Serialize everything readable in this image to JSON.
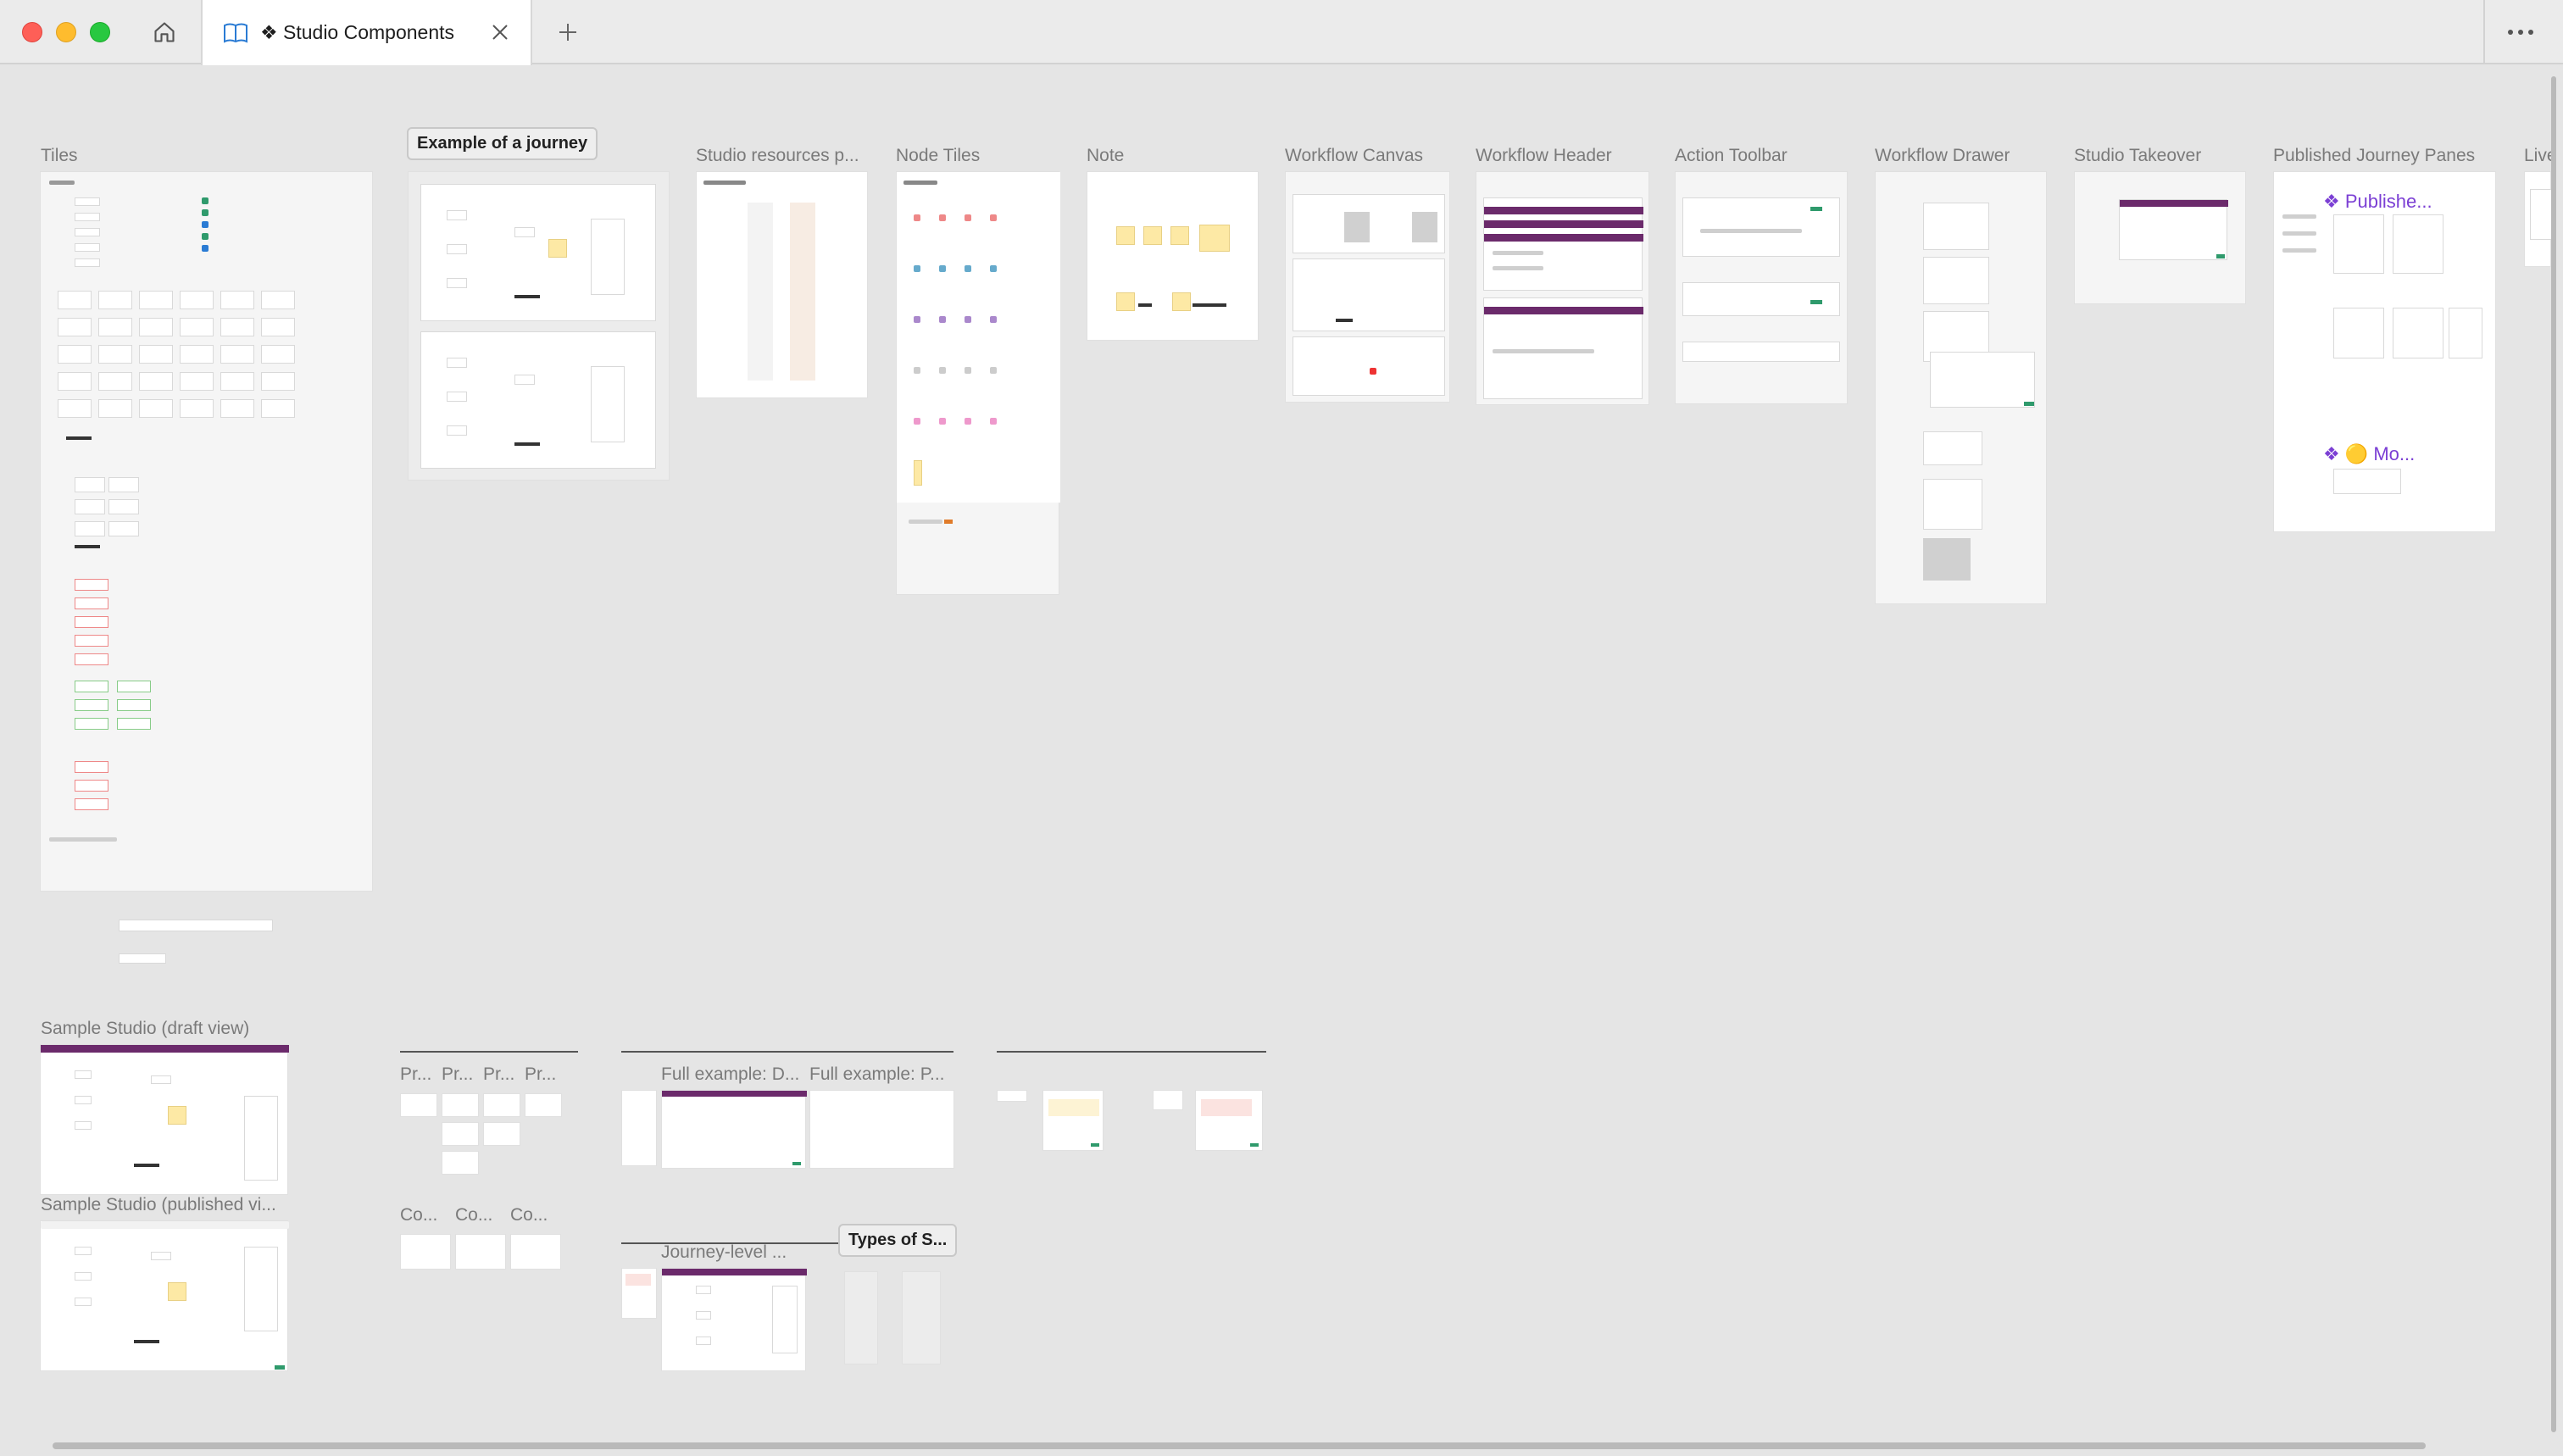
{
  "window": {
    "tab_title": "❖ Studio Components",
    "icons": {
      "home": "home-icon",
      "book": "book-icon",
      "close": "close-icon",
      "add": "plus-icon",
      "more": "more-icon"
    },
    "colors": {
      "close_light": "#fe5f57",
      "minimize_light": "#febc2e",
      "zoom_light": "#28c840",
      "accent": "#6b2a6b"
    }
  },
  "canvas": {
    "frames": {
      "tiles": "Tiles",
      "journey_example": "Example of a journey",
      "studio_resources": "Studio resources p...",
      "node_tiles": "Node Tiles",
      "note": "Note",
      "workflow_canvas": "Workflow Canvas",
      "workflow_header": "Workflow Header",
      "action_toolbar": "Action Toolbar",
      "workflow_drawer": "Workflow Drawer",
      "studio_takeover": "Studio Takeover",
      "published_panes": "Published Journey Panes",
      "live": "Live",
      "sample_draft": "Sample Studio (draft view)",
      "sample_published": "Sample Studio (published vi...",
      "full_example_d": "Full example: D...",
      "full_example_p": "Full example: P...",
      "journey_level": "Journey-level ...",
      "types_of_s": "Types of S..."
    },
    "inner_titles": {
      "published_panes_1": "❖ Publishe...",
      "published_panes_2": "❖ 🟡 Mo..."
    },
    "small_labels": {
      "pr": "Pr...",
      "co": "Co..."
    }
  }
}
